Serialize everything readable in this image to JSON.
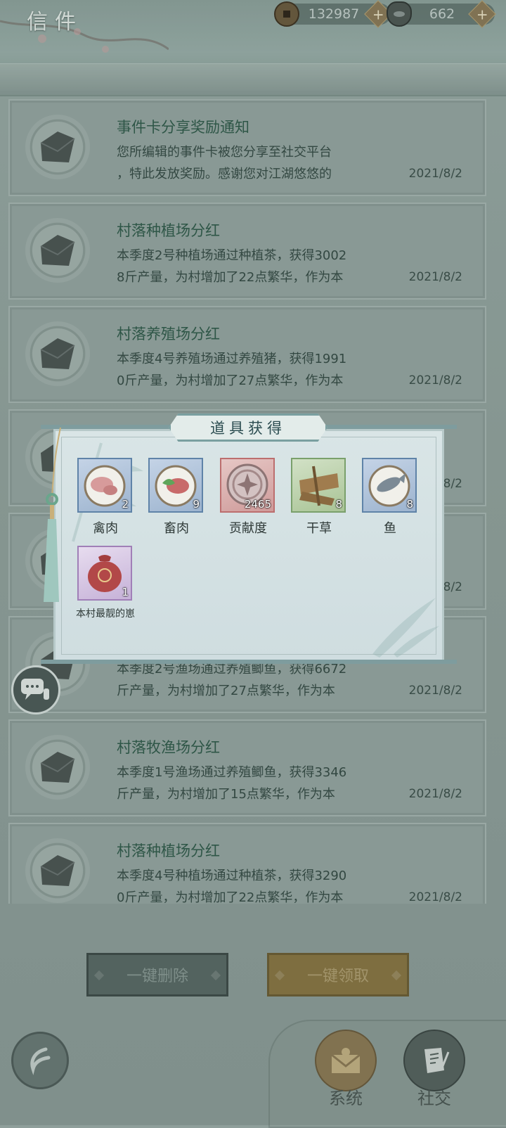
{
  "header": {
    "title": "信件",
    "copper": "132987",
    "ingot": "662"
  },
  "mails": [
    {
      "subject": "事件卡分享奖励通知",
      "body": "您所编辑的事件卡被您分享至社交平台\n，特此发放奖励。感谢您对江湖悠悠的",
      "date": "2021/8/2"
    },
    {
      "subject": "村落种植场分红",
      "body": "本季度2号种植场通过种植茶，获得3002\n8斤产量，为村增加了22点繁华，作为本",
      "date": "2021/8/2"
    },
    {
      "subject": "村落养殖场分红",
      "body": "本季度4号养殖场通过养殖猪，获得1991\n0斤产量，为村增加了27点繁华，作为本",
      "date": "2021/8/2"
    },
    {
      "subject": "",
      "body": "",
      "date": "2021/8/2"
    },
    {
      "subject": "",
      "body": "",
      "date": "2021/8/2"
    },
    {
      "subject": "",
      "body": "本季度2号渔场通过养殖鲫鱼，获得6672\n斤产量，为村增加了27点繁华，作为本",
      "date": "2021/8/2"
    },
    {
      "subject": "村落牧渔场分红",
      "body": "本季度1号渔场通过养殖鲫鱼，获得3346\n斤产量，为村增加了15点繁华，作为本",
      "date": "2021/8/2"
    },
    {
      "subject": "村落种植场分红",
      "body": "本季度4号种植场通过种植茶，获得3290\n0斤产量，为村增加了22点繁华，作为本",
      "date": "2021/8/2"
    }
  ],
  "popup": {
    "title": "道具获得",
    "items": [
      {
        "name": "禽肉",
        "count": "2",
        "icon": "poultry-meat-icon"
      },
      {
        "name": "畜肉",
        "count": "9",
        "icon": "livestock-meat-icon"
      },
      {
        "name": "贡献度",
        "count": "2465",
        "icon": "contribution-coin-icon"
      },
      {
        "name": "干草",
        "count": "8",
        "icon": "hay-icon"
      },
      {
        "name": "鱼",
        "count": "8",
        "icon": "fish-icon"
      },
      {
        "name": "本村最靓的崽",
        "count": "1",
        "icon": "lucky-bag-icon"
      }
    ]
  },
  "buttons": {
    "delete_all": "一键删除",
    "claim_all": "一键领取"
  },
  "tabs": {
    "system": "系统",
    "social": "社交"
  }
}
